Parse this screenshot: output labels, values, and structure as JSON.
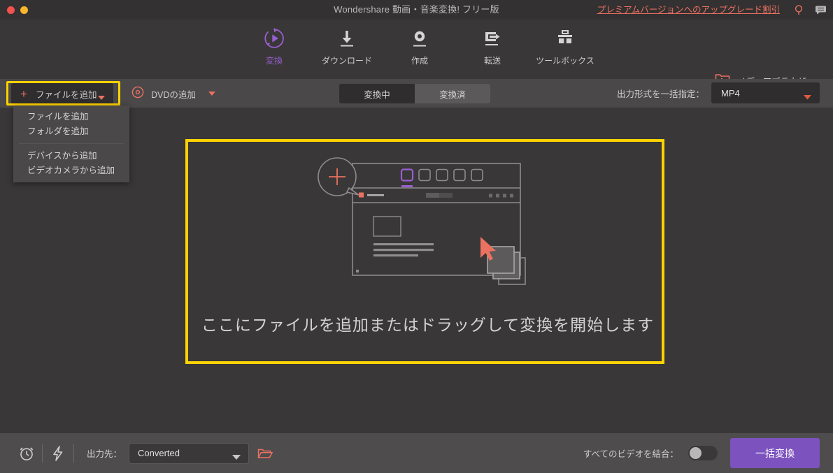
{
  "window": {
    "title": "Wondershare 動画・音楽変換! フリー版",
    "controls": [
      "close",
      "minimize"
    ],
    "upgrade_link": "プレミアムバージョンへのアップグレード割引",
    "icons": [
      {
        "name": "search-icon",
        "color": "#eb7160"
      },
      {
        "name": "feedback-icon",
        "color": "#b6b4b4"
      }
    ]
  },
  "nav": {
    "items": [
      {
        "label": "変換",
        "icon": "convert-icon",
        "active": true
      },
      {
        "label": "ダウンロード",
        "icon": "download-icon",
        "active": false
      },
      {
        "label": "作成",
        "icon": "record-icon",
        "active": false
      },
      {
        "label": "転送",
        "icon": "transfer-icon",
        "active": false
      },
      {
        "label": "ツールボックス",
        "icon": "toolbox-icon",
        "active": false
      }
    ],
    "media_browser": {
      "label": "メディアブラウザ",
      "icon": "media-folder-icon"
    }
  },
  "toolbar": {
    "add_file_label": "ファイルを追加",
    "add_dvd_label": "DVDの追加",
    "tabs": [
      {
        "label": "変換中",
        "active": true
      },
      {
        "label": "変換済",
        "active": false
      }
    ],
    "format_label": "出力形式を一括指定：",
    "format_value": "MP4"
  },
  "dropdown_menu": {
    "groups": [
      [
        "ファイルを追加",
        "フォルダを追加"
      ],
      [
        "デバイスから追加",
        "ビデオカメラから追加"
      ]
    ]
  },
  "dropzone": {
    "text": "ここにファイルを追加またはドラッグして変換を開始します",
    "border_color": "#ffd200"
  },
  "bottom": {
    "alarm_icon": "alarm-clock-icon",
    "bolt_icon": "lightning-bolt-icon",
    "output_label": "出力先：",
    "output_value": "Converted",
    "folder_icon": "open-folder-icon",
    "merge_label": "すべてのビデオを結合：",
    "merge_on": false,
    "convert_button": "一括変換"
  },
  "colors": {
    "accent_purple": "#7c52bf",
    "accent_red": "#eb7160",
    "highlight_yellow": "#ffd200",
    "bg": "#393738",
    "toolbar_bg": "#4a4849",
    "bottom_bg": "#4e4c4d"
  }
}
